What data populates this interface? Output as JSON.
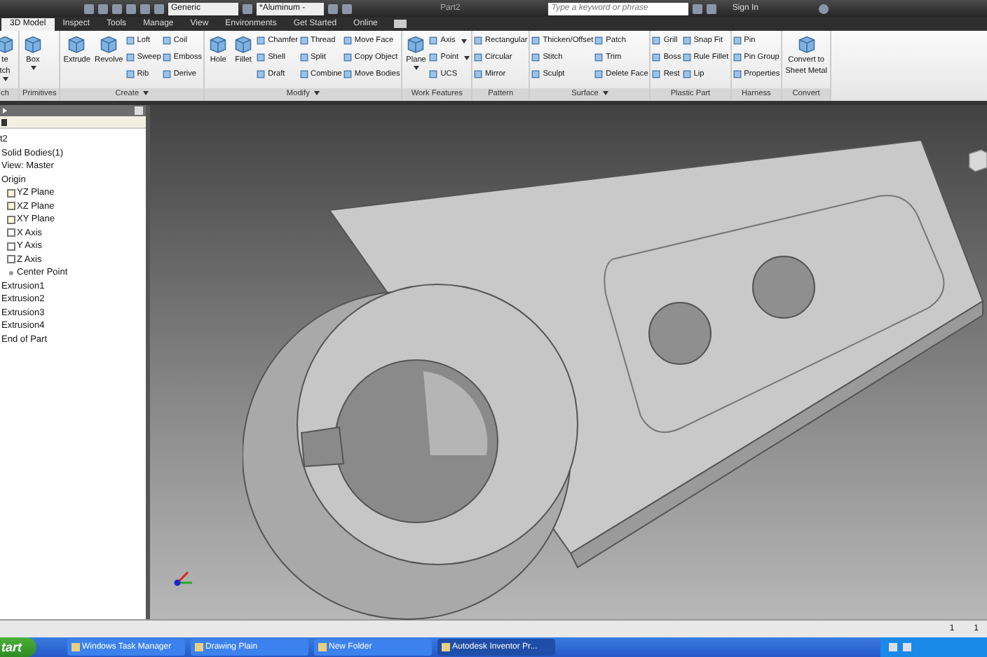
{
  "title_bar": {
    "title": "Part2",
    "style_dropdown": "Generic",
    "material_dropdown": "*Aluminum -",
    "search": {
      "placeholder": "Type a keyword or phrase"
    },
    "sign_in": "Sign In"
  },
  "tabs": [
    {
      "label": "3D Model",
      "selected": true
    },
    {
      "label": "Inspect",
      "selected": false
    },
    {
      "label": "Tools",
      "selected": false
    },
    {
      "label": "Manage",
      "selected": false
    },
    {
      "label": "View",
      "selected": false
    },
    {
      "label": "Environments",
      "selected": false
    },
    {
      "label": "Get Started",
      "selected": false
    },
    {
      "label": "Online",
      "selected": false
    }
  ],
  "ribbon": [
    {
      "label": "ch",
      "large": [
        {
          "lines": [
            "te",
            "tch"
          ],
          "caret": true
        }
      ]
    },
    {
      "label": "Primitives",
      "large": [
        {
          "lines": [
            "Box"
          ],
          "caret": true
        }
      ]
    },
    {
      "label": "Create",
      "menu": true,
      "large": [
        {
          "lines": [
            "Extrude"
          ]
        },
        {
          "lines": [
            "Revolve"
          ]
        }
      ],
      "columns": [
        [
          {
            "label": "Loft"
          },
          {
            "label": "Sweep"
          },
          {
            "label": "Rib"
          }
        ],
        [
          {
            "label": "Coil"
          },
          {
            "label": "Emboss"
          },
          {
            "label": "Derive"
          }
        ]
      ]
    },
    {
      "label": "Modify",
      "menu": true,
      "large": [
        {
          "lines": [
            "Hole"
          ]
        },
        {
          "lines": [
            "Fillet"
          ]
        }
      ],
      "columns": [
        [
          {
            "label": "Chamfer"
          },
          {
            "label": "Shell"
          },
          {
            "label": "Draft"
          }
        ],
        [
          {
            "label": "Thread"
          },
          {
            "label": "Split"
          },
          {
            "label": "Combine"
          }
        ],
        [
          {
            "label": "Move Face"
          },
          {
            "label": "Copy Object"
          },
          {
            "label": "Move Bodies"
          }
        ]
      ]
    },
    {
      "label": "Work Features",
      "large": [
        {
          "lines": [
            "Plane"
          ],
          "caret": true
        }
      ],
      "columns": [
        [
          {
            "label": "Axis",
            "caret": true
          },
          {
            "label": "Point",
            "caret": true
          },
          {
            "label": "UCS"
          }
        ]
      ]
    },
    {
      "label": "Pattern",
      "columns": [
        [
          {
            "label": "Rectangular"
          },
          {
            "label": "Circular"
          },
          {
            "label": "Mirror"
          }
        ]
      ]
    },
    {
      "label": "Surface",
      "menu": true,
      "columns": [
        [
          {
            "label": "Thicken/Offset"
          },
          {
            "label": "Stitch"
          },
          {
            "label": "Sculpt"
          }
        ],
        [
          {
            "label": "Patch"
          },
          {
            "label": "Trim"
          },
          {
            "label": "Delete Face"
          }
        ]
      ]
    },
    {
      "label": "Plastic Part",
      "columns": [
        [
          {
            "label": "Grill"
          },
          {
            "label": "Boss"
          },
          {
            "label": "Rest"
          }
        ],
        [
          {
            "label": "Snap Fit"
          },
          {
            "label": "Rule Fillet"
          },
          {
            "label": "Lip"
          }
        ]
      ]
    },
    {
      "label": "Harness",
      "columns": [
        [
          {
            "label": "Pin"
          },
          {
            "label": "Pin Group"
          },
          {
            "label": "Properties"
          }
        ]
      ]
    },
    {
      "label": "Convert",
      "large": [
        {
          "lines": [
            "Convert to",
            "Sheet Metal"
          ]
        }
      ]
    }
  ],
  "browser": {
    "items": [
      {
        "label": "t2",
        "children": [
          {
            "label": "Solid Bodies(1)"
          },
          {
            "label": "View: Master"
          },
          {
            "label": "Origin",
            "children": [
              {
                "label": "YZ Plane",
                "kind": "plane"
              },
              {
                "label": "XZ Plane",
                "kind": "plane"
              },
              {
                "label": "XY Plane",
                "kind": "plane"
              },
              {
                "label": "X Axis",
                "kind": "axis"
              },
              {
                "label": "Y Axis",
                "kind": "axis"
              },
              {
                "label": "Z Axis",
                "kind": "axis"
              },
              {
                "label": "Center Point",
                "kind": "point"
              }
            ]
          },
          {
            "label": "Extrusion1"
          },
          {
            "label": "Extrusion2"
          },
          {
            "label": "Extrusion3"
          },
          {
            "label": "Extrusion4"
          },
          {
            "label": "End of Part"
          }
        ]
      }
    ]
  },
  "status_bar": [
    "1",
    "1"
  ],
  "taskbar": {
    "start": "tart",
    "items": [
      {
        "label": "Windows Task Manager",
        "active": false
      },
      {
        "label": "Drawing Plain",
        "active": false
      },
      {
        "label": "New Folder",
        "active": false
      },
      {
        "label": "Autodesk Inventor Pr...",
        "active": true
      }
    ]
  }
}
